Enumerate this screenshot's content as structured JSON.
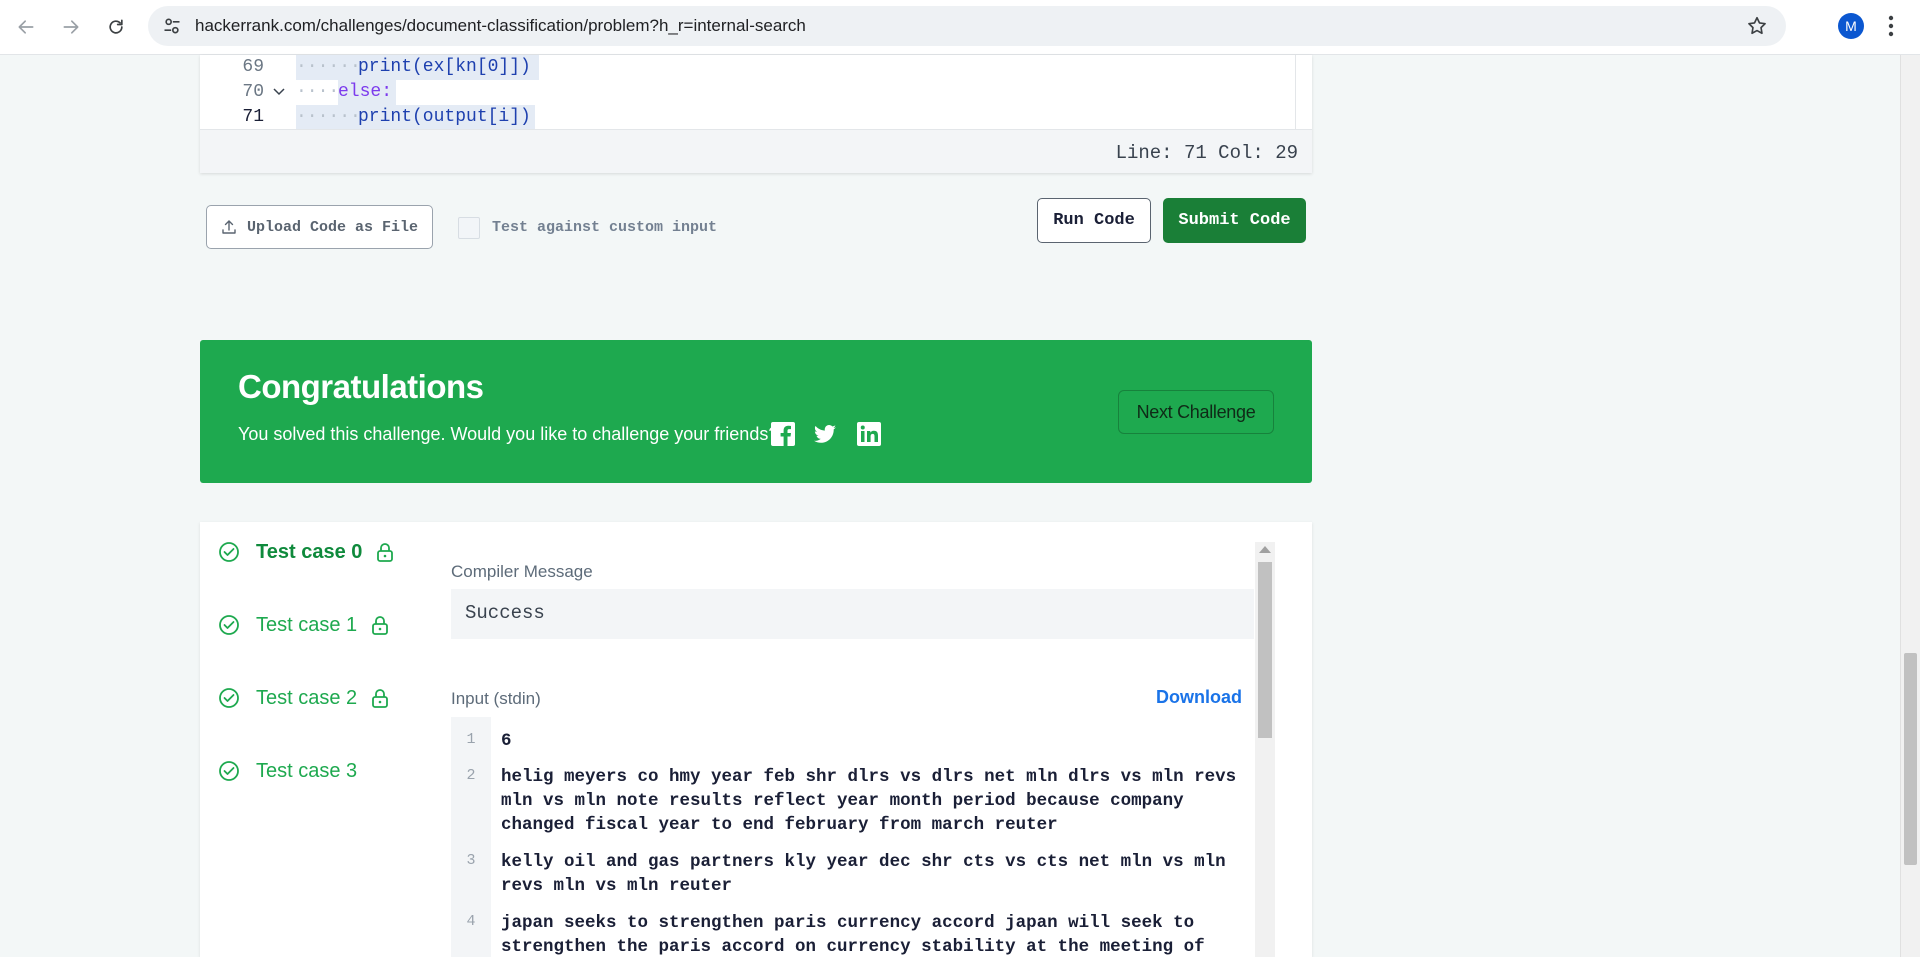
{
  "browser": {
    "url": "hackerrank.com/challenges/document-classification/problem?h_r=internal-search",
    "profile_initial": "M"
  },
  "editor": {
    "lines": [
      {
        "num": "69",
        "code": "print(ex[kn[0]])"
      },
      {
        "num": "70",
        "code": "else:"
      },
      {
        "num": "71",
        "code": "print(output[i])"
      }
    ],
    "cursor_position": "Line: 71 Col: 29"
  },
  "actions": {
    "upload_label": "Upload Code as File",
    "custom_input_label": "Test against custom input",
    "custom_input_checked": false,
    "run_label": "Run Code",
    "submit_label": "Submit Code"
  },
  "congrats": {
    "title": "Congratulations",
    "subtitle": "You solved this challenge. Would you like to challenge your friends?",
    "next_label": "Next Challenge"
  },
  "results": {
    "test_cases": [
      {
        "label": "Test case 0",
        "locked": true,
        "active": true
      },
      {
        "label": "Test case 1",
        "locked": true,
        "active": false
      },
      {
        "label": "Test case 2",
        "locked": true,
        "active": false
      },
      {
        "label": "Test case 3",
        "locked": false,
        "active": false
      }
    ],
    "compiler_label": "Compiler Message",
    "compiler_message": "Success",
    "input_label": "Input (stdin)",
    "download_label": "Download",
    "stdin_lines": [
      {
        "num": "1",
        "text": "6"
      },
      {
        "num": "2",
        "text": "helig meyers co hmy year feb shr dlrs vs dlrs net mln dlrs vs mln revs mln vs mln note results reflect year month period because company changed fiscal year to end february from march reuter"
      },
      {
        "num": "3",
        "text": "kelly oil and gas partners kly year dec shr cts vs cts net mln vs mln revs mln vs mln reuter"
      },
      {
        "num": "4",
        "text": "japan seeks to strengthen paris currency accord japan will seek to strengthen the paris accord on currency stability at the meeting of"
      }
    ]
  },
  "colors": {
    "accent_green": "#1ea94f",
    "submit_green": "#1a7f37",
    "link_blue": "#1a73e8"
  }
}
